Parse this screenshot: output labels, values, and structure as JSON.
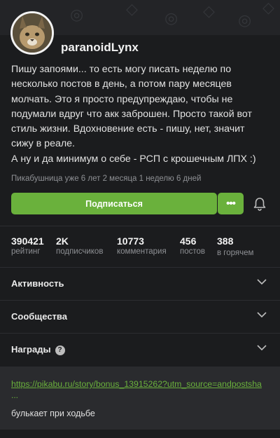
{
  "profile": {
    "username": "paranoidLynx",
    "bio_lines": [
      "Пишу запоями... то есть могу писать неделю по",
      "несколько постов в день, а потом пару месяцев",
      "молчать. Это я просто предупреждаю, чтобы не",
      "подумали вдруг что акк заброшен. Просто такой вот",
      "стиль жизни. Вдохновение есть - пишу, нет, значит",
      "сижу в реале.",
      "А ну и да минимум о себе - РСП с крошечным ЛПХ :)"
    ],
    "since": "Пикабушница уже 6 лет 2 месяца 1 неделю 6 дней",
    "avatar_icon": "lynx-avatar"
  },
  "actions": {
    "subscribe_label": "Подписаться",
    "more_label": "•••",
    "bell_icon": "bell-icon"
  },
  "stats": [
    {
      "value": "390421",
      "label": "рейтинг"
    },
    {
      "value": "2K",
      "label": "подписчиков"
    },
    {
      "value": "10773",
      "label": "комментария"
    },
    {
      "value": "456",
      "label": "постов"
    },
    {
      "value": "388",
      "label": "в горячем"
    }
  ],
  "sections": [
    {
      "title": "Активность"
    },
    {
      "title": "Сообщества"
    },
    {
      "title": "Награды",
      "help": "?"
    }
  ],
  "post_block": {
    "link_text": "https://pikabu.ru/story/bonus_13915262?utm_source=andpostsha",
    "link_cont": "...",
    "note": "булькает при ходьбе"
  },
  "colors": {
    "accent": "#6ab13c",
    "background": "#1b1c1e",
    "text": "#e8e8e8",
    "muted": "#8e9094"
  }
}
